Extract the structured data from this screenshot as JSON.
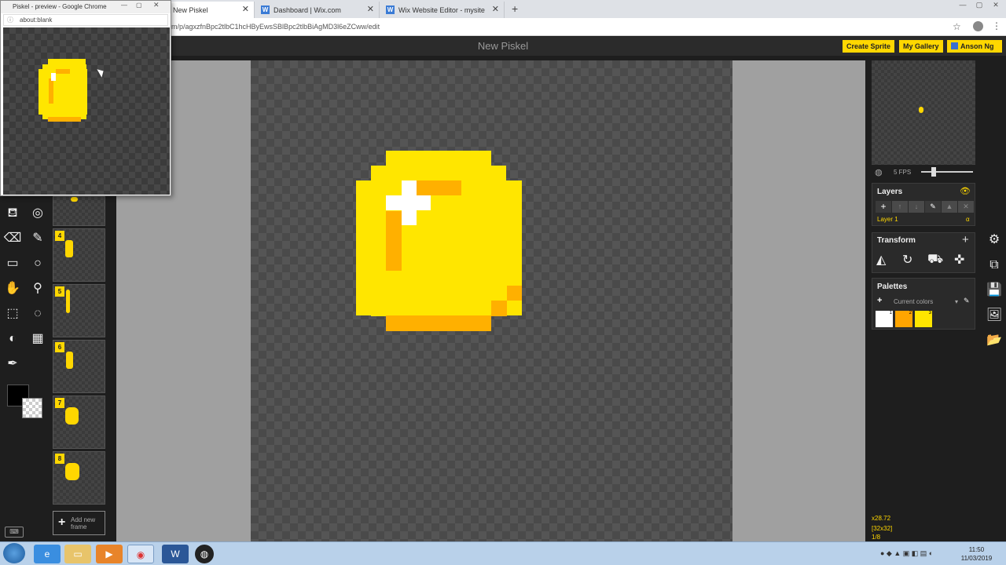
{
  "popup": {
    "title": "Piskel - preview - Google Chrome",
    "address": "about:blank"
  },
  "tabs": [
    {
      "label": "New Piskel"
    },
    {
      "label": "Dashboard | Wix.com"
    },
    {
      "label": "Wix Website Editor - mysite"
    }
  ],
  "address_bar": {
    "url": "m/p/agxzfnBpc2tlbC1hcHByEwsSBlBpc2tlbBiAgMD3l6eZCww/edit"
  },
  "header": {
    "title": "New Piskel",
    "create_sprite": "Create Sprite",
    "my_gallery": "My Gallery",
    "user": "Anson Ng"
  },
  "frames": [
    {
      "number": "4"
    },
    {
      "number": "5"
    },
    {
      "number": "6"
    },
    {
      "number": "7"
    },
    {
      "number": "8"
    }
  ],
  "add_frame": {
    "line1": "Add new",
    "line2": "frame"
  },
  "fps": "5 FPS",
  "layers": {
    "title": "Layers",
    "layer_name": "Layer 1",
    "alpha_symbol": "α"
  },
  "transform": {
    "title": "Transform"
  },
  "palettes": {
    "title": "Palettes",
    "selector": "Current colors",
    "swatches": [
      {
        "num": "1",
        "color": "#ffffff"
      },
      {
        "num": "2",
        "color": "#ffa500"
      },
      {
        "num": "3",
        "color": "#ffe600"
      }
    ]
  },
  "status": {
    "cursor": "x28.72",
    "size": "[32x32]",
    "frame": "1/8"
  },
  "taskbar": {
    "time": "11:50",
    "date": "11/03/2019"
  },
  "colors": {
    "accent": "#ffd700",
    "coin_yellow": "#ffe600",
    "coin_orange": "#ffb000",
    "coin_white": "#ffffff"
  }
}
